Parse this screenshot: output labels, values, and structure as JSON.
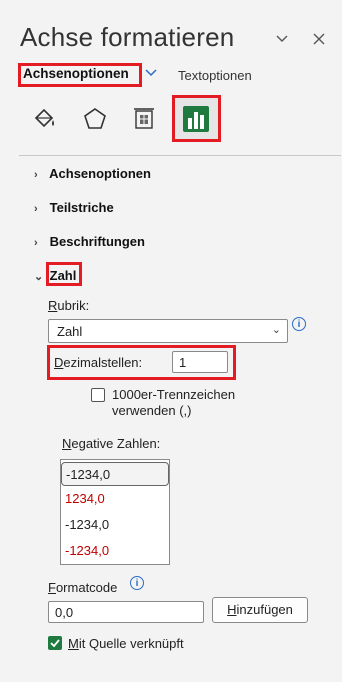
{
  "header": {
    "title": "Achse formatieren",
    "collapse_icon": "chevron-down-icon",
    "close_icon": "close-icon"
  },
  "tabs": {
    "axis_options": "Achsenoptionen",
    "text_options": "Textoptionen"
  },
  "icons": [
    "fill-line-icon",
    "effects-icon",
    "size-properties-icon",
    "axis-options-icon"
  ],
  "sections": {
    "axis_options": "Achsenoptionen",
    "tick_marks": "Teilstriche",
    "labels": "Beschriftungen",
    "number": "Zahl"
  },
  "number": {
    "category_label": "Rubrik:",
    "category_value": "Zahl",
    "decimals_label": "Dezimalstellen:",
    "decimals_value": "1",
    "thousands_label_line1": "1000er-Trennzeichen",
    "thousands_label_line2": "verwenden (,)",
    "thousands_checked": false,
    "negative_label": "Negative Zahlen:",
    "negative_options": [
      {
        "text": "-1234,0",
        "color": "#222222",
        "selected": true
      },
      {
        "text": "1234,0",
        "color": "#c00000",
        "selected": false
      },
      {
        "text": "-1234,0",
        "color": "#222222",
        "selected": false
      },
      {
        "text": "-1234,0",
        "color": "#c00000",
        "selected": false
      }
    ],
    "format_code_label": "Formatcode",
    "format_code_value": "0,0",
    "add_button": "Hinzufügen",
    "linked_label": "Mit Quelle verknüpft",
    "linked_checked": true
  },
  "colors": {
    "accent": "#2b6cc4",
    "highlight": "#e31b23",
    "chart_green": "#1e7a3e"
  }
}
